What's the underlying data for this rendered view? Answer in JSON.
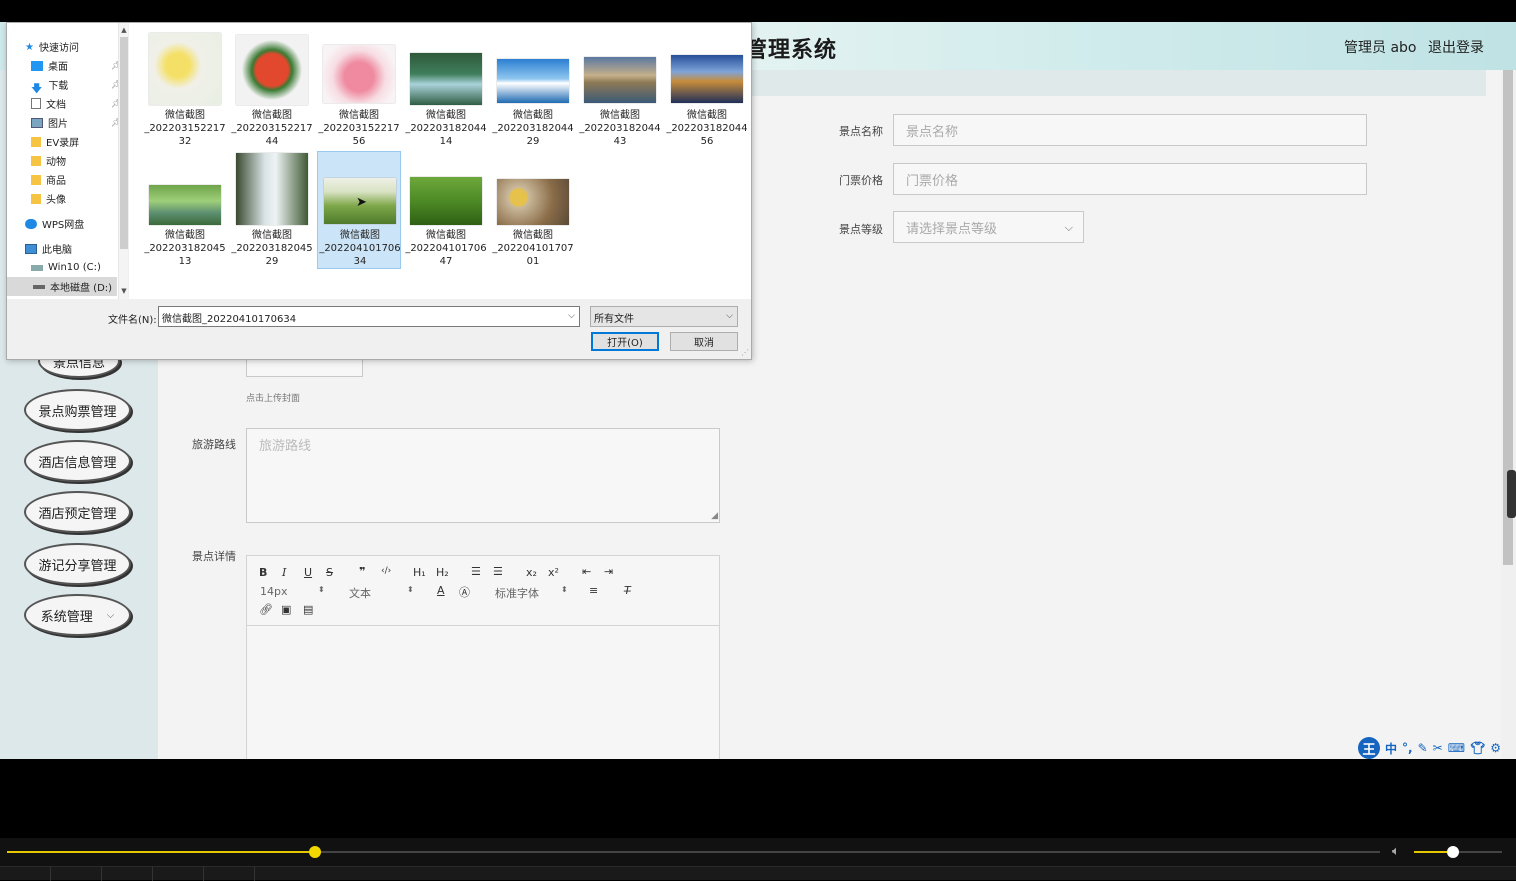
{
  "header": {
    "title": "管理系统",
    "admin_label": "管理员 abo",
    "logout_label": "退出登录"
  },
  "sidebar": {
    "items": [
      {
        "label": "景点信息"
      },
      {
        "label": "景点购票管理"
      },
      {
        "label": "酒店信息管理"
      },
      {
        "label": "酒店预定管理"
      },
      {
        "label": "游记分享管理"
      },
      {
        "label": "系统管理"
      }
    ]
  },
  "form": {
    "name_label": "景点名称",
    "name_placeholder": "景点名称",
    "price_label": "门票价格",
    "price_placeholder": "门票价格",
    "level_label": "景点等级",
    "level_placeholder": "请选择景点等级",
    "upload_hint": "点击上传封面",
    "route_label": "旅游路线",
    "route_placeholder": "旅游路线",
    "detail_label": "景点详情"
  },
  "editor": {
    "font_size": "14px",
    "block_type": "文本",
    "font_family": "标准字体"
  },
  "dialog": {
    "nav": [
      {
        "label": "快速访问",
        "icon": "star-icon"
      },
      {
        "label": "桌面",
        "icon": "desktop-icon"
      },
      {
        "label": "下载",
        "icon": "download-icon"
      },
      {
        "label": "文档",
        "icon": "document-icon"
      },
      {
        "label": "图片",
        "icon": "picture-icon"
      },
      {
        "label": "EV录屏",
        "icon": "folder-icon"
      },
      {
        "label": "动物",
        "icon": "folder-icon"
      },
      {
        "label": "商品",
        "icon": "folder-icon"
      },
      {
        "label": "头像",
        "icon": "folder-icon"
      },
      {
        "label": "WPS网盘",
        "icon": "cloud-icon"
      },
      {
        "label": "此电脑",
        "icon": "computer-icon"
      },
      {
        "label": "Win10 (C:)",
        "icon": "drive-icon"
      },
      {
        "label": "本地磁盘 (D:)",
        "icon": "drive-icon"
      }
    ],
    "files": [
      {
        "line1": "微信截图",
        "line2": "_202203152217",
        "line3": "32"
      },
      {
        "line1": "微信截图",
        "line2": "_202203152217",
        "line3": "44"
      },
      {
        "line1": "微信截图",
        "line2": "_202203152217",
        "line3": "56"
      },
      {
        "line1": "微信截图",
        "line2": "_202203182044",
        "line3": "14"
      },
      {
        "line1": "微信截图",
        "line2": "_202203182044",
        "line3": "29"
      },
      {
        "line1": "微信截图",
        "line2": "_202203182044",
        "line3": "43"
      },
      {
        "line1": "微信截图",
        "line2": "_202203182044",
        "line3": "56"
      },
      {
        "line1": "微信截图",
        "line2": "_202203182045",
        "line3": "13"
      },
      {
        "line1": "微信截图",
        "line2": "_202203182045",
        "line3": "29"
      },
      {
        "line1": "微信截图",
        "line2": "_202204101706",
        "line3": "34"
      },
      {
        "line1": "微信截图",
        "line2": "_202204101706",
        "line3": "47"
      },
      {
        "line1": "微信截图",
        "line2": "_202204101707",
        "line3": "01"
      }
    ],
    "filename_label": "文件名(N):",
    "filename_value": "微信截图_20220410170634",
    "filetype_value": "所有文件",
    "open_label": "打开(O)",
    "cancel_label": "取消"
  },
  "ime": {
    "logo": "王",
    "mode": "中"
  },
  "player": {
    "progress": 0.224,
    "volume": 0.44,
    "accent": "#e6c800"
  }
}
